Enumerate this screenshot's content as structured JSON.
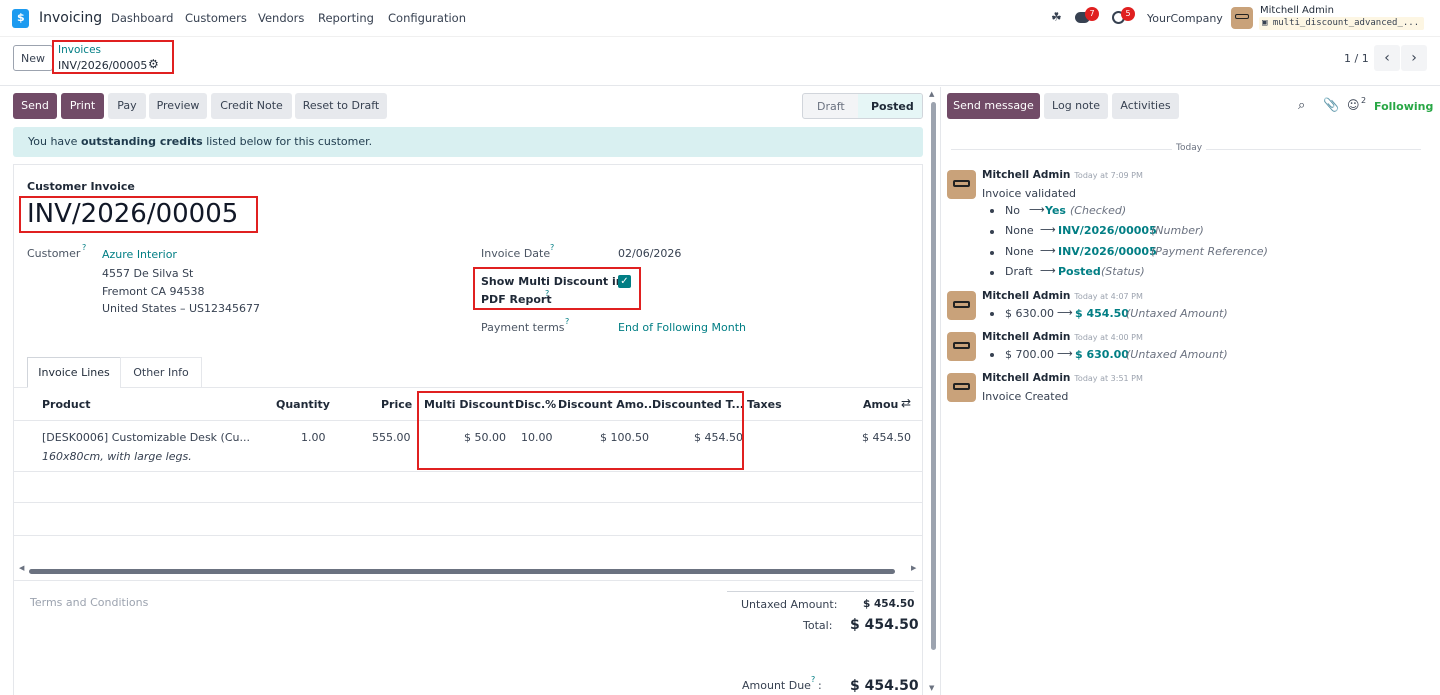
{
  "navbar": {
    "app_name": "Invoicing",
    "menu": [
      "Dashboard",
      "Customers",
      "Vendors",
      "Reporting",
      "Configuration"
    ],
    "messages_count": "7",
    "activities_count": "5",
    "company": "YourCompany",
    "user_name": "Mitchell Admin",
    "user_db": "multi_discount_advanced_..."
  },
  "control_panel": {
    "new_label": "New",
    "breadcrumb_parent": "Invoices",
    "breadcrumb_current": "INV/2026/00005",
    "pager": "1 / 1"
  },
  "actions": {
    "send": "Send",
    "print": "Print",
    "pay": "Pay",
    "preview": "Preview",
    "credit_note": "Credit Note",
    "reset": "Reset to Draft"
  },
  "status": {
    "draft": "Draft",
    "posted": "Posted"
  },
  "alert": {
    "prefix": "You have ",
    "bold": "outstanding credits",
    "suffix": " listed below for this customer."
  },
  "form": {
    "type_label": "Customer Invoice",
    "name": "INV/2026/00005",
    "customer_label": "Customer",
    "customer_name": "Azure Interior",
    "address_line1": "4557 De Silva St",
    "address_line2": "Fremont CA 94538",
    "address_line3": "United States – US12345677",
    "invoice_date_label": "Invoice Date",
    "invoice_date": "02/06/2026",
    "multi_discount_label_1": "Show Multi Discount in",
    "multi_discount_label_2": "PDF Report",
    "multi_discount_checked": true,
    "payment_terms_label": "Payment terms",
    "payment_terms": "End of Following Month"
  },
  "tabs": [
    "Invoice Lines",
    "Other Info"
  ],
  "table": {
    "headers": {
      "product": "Product",
      "quantity": "Quantity",
      "price": "Price",
      "multi_discount": "Multi Discount",
      "disc": "Disc.%",
      "discount_amount": "Discount Amo...",
      "discounted_total": "Discounted T...",
      "taxes": "Taxes",
      "amount": "Amou"
    },
    "rows": [
      {
        "product": "[DESK0006] Customizable Desk (Cu...",
        "description": "160x80cm, with large legs.",
        "quantity": "1.00",
        "price": "555.00",
        "multi_discount": "$ 50.00",
        "disc": "10.00",
        "discount_amount": "$ 100.50",
        "discounted_total": "$ 454.50",
        "taxes": "",
        "amount": "$ 454.50"
      }
    ]
  },
  "footer": {
    "terms_placeholder": "Terms and Conditions",
    "untaxed_label": "Untaxed Amount:",
    "untaxed_value": "$ 454.50",
    "total_label": "Total:",
    "total_value": "$ 454.50",
    "due_label": "Amount Due",
    "due_value": "$ 454.50"
  },
  "chatter": {
    "send_message": "Send message",
    "log_note": "Log note",
    "activities": "Activities",
    "followers_count": "2",
    "following": "Following",
    "date_separator": "Today",
    "messages": [
      {
        "author": "Mitchell Admin",
        "time": "Today at 7:09 PM",
        "body": "Invoice validated",
        "changes": [
          {
            "old": "No",
            "new": "Yes",
            "field": "(Checked)"
          },
          {
            "old": "None",
            "new": "INV/2026/00005",
            "field": "(Number)"
          },
          {
            "old": "None",
            "new": "INV/2026/00005",
            "field": "(Payment Reference)"
          },
          {
            "old": "Draft",
            "new": "Posted",
            "field": "(Status)"
          }
        ]
      },
      {
        "author": "Mitchell Admin",
        "time": "Today at 4:07 PM",
        "changes": [
          {
            "old": "$ 630.00",
            "new": "$ 454.50",
            "field": "(Untaxed Amount)"
          }
        ]
      },
      {
        "author": "Mitchell Admin",
        "time": "Today at 4:00 PM",
        "changes": [
          {
            "old": "$ 700.00",
            "new": "$ 630.00",
            "field": "(Untaxed Amount)"
          }
        ]
      },
      {
        "author": "Mitchell Admin",
        "time": "Today at 3:51 PM",
        "body": "Invoice Created"
      }
    ]
  },
  "colors": {
    "primary": "#714b67",
    "link": "#017e84",
    "highlight": "#e02020",
    "alert_bg": "#d9f0f1"
  }
}
